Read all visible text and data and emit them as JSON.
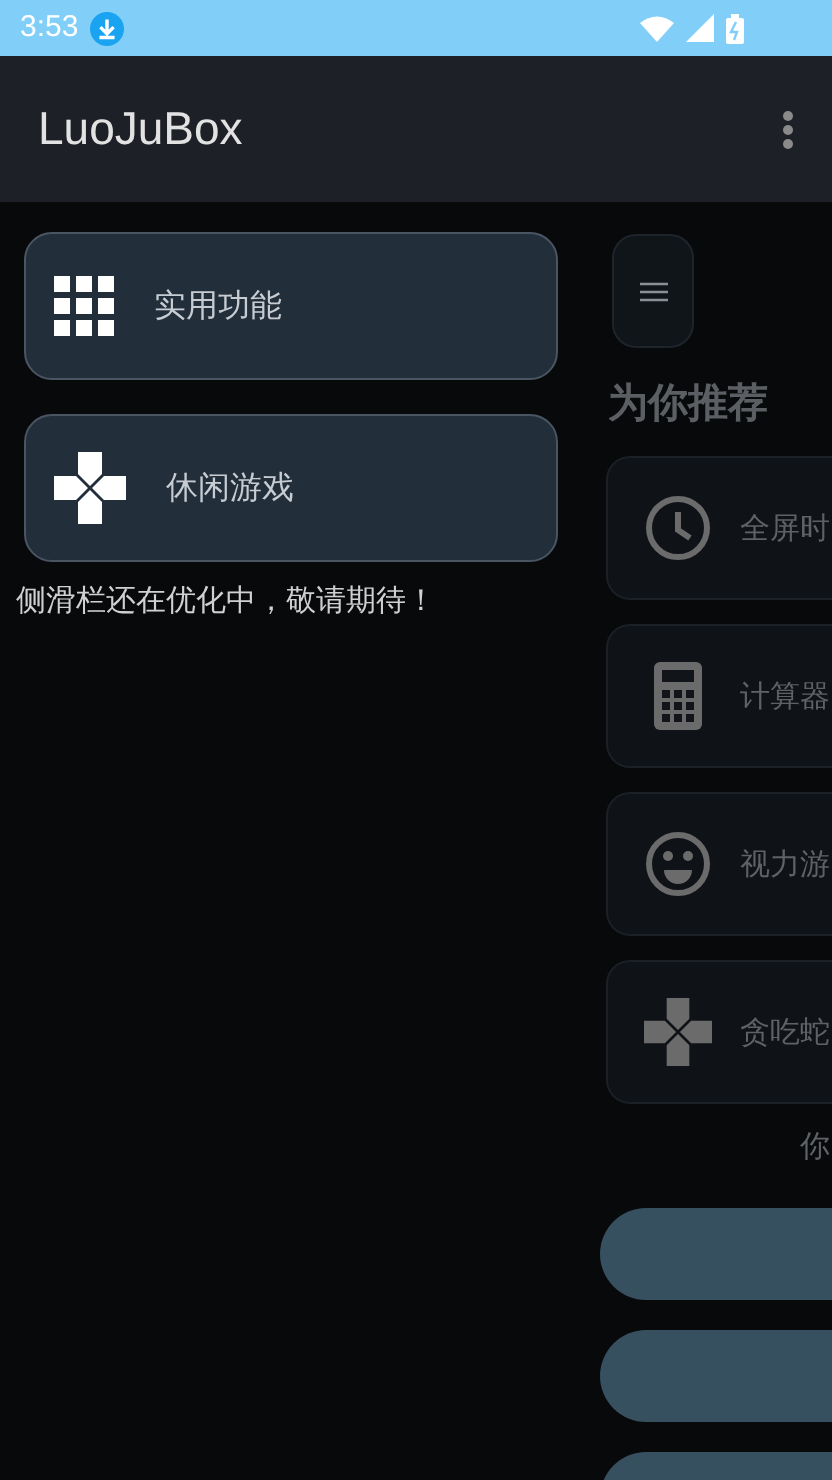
{
  "status_bar": {
    "time": "3:53"
  },
  "app_bar": {
    "title": "LuoJuBox"
  },
  "drawer": {
    "items": [
      {
        "label": "实用功能",
        "kind": "grid"
      },
      {
        "label": "休闲游戏",
        "kind": "gamepad"
      }
    ],
    "note": "侧滑栏还在优化中，敬请期待！"
  },
  "main": {
    "heading": "为你推荐",
    "items": [
      {
        "label": "全屏时",
        "kind": "clock"
      },
      {
        "label": "计算器",
        "kind": "calculator"
      },
      {
        "label": "视力游",
        "kind": "smiley"
      },
      {
        "label": "贪吃蛇",
        "kind": "gamepad"
      }
    ],
    "footer_text": "你",
    "buttons": [
      {
        "kind": "pill"
      },
      {
        "kind": "pill"
      },
      {
        "kind": "pill"
      }
    ]
  }
}
